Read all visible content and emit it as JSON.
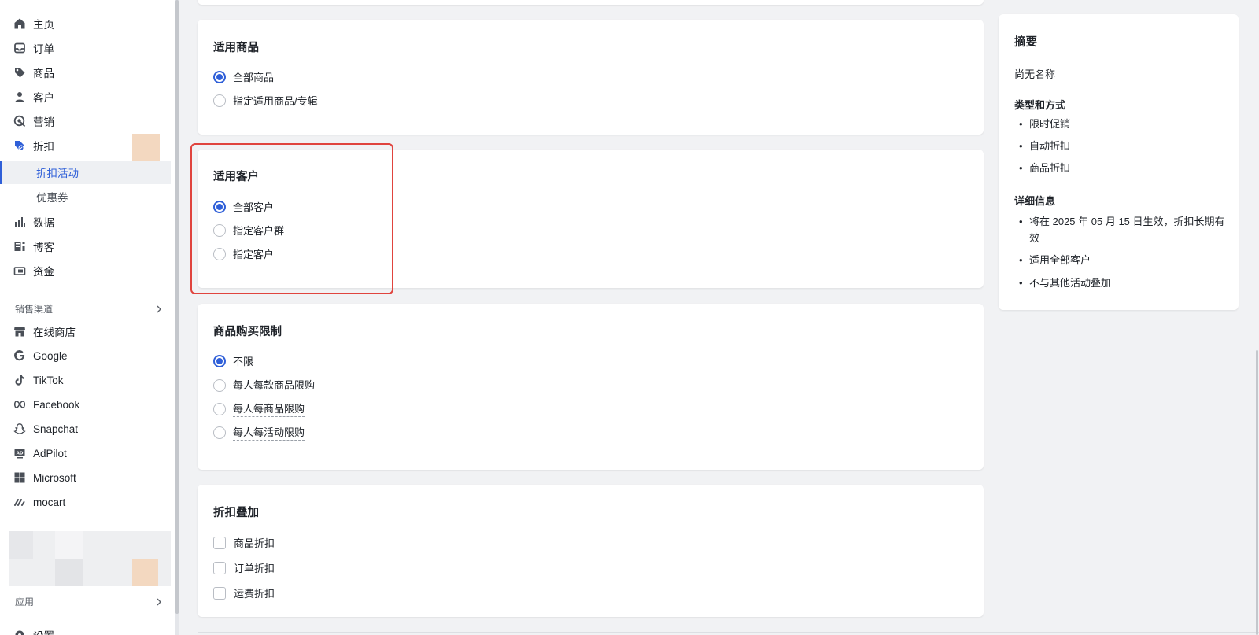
{
  "sidebar": {
    "items": [
      {
        "label": "主页"
      },
      {
        "label": "订单"
      },
      {
        "label": "商品"
      },
      {
        "label": "客户"
      },
      {
        "label": "营销"
      },
      {
        "label": "折扣"
      }
    ],
    "sub_items": [
      {
        "label": "折扣活动",
        "active": true
      },
      {
        "label": "优惠券"
      }
    ],
    "items2": [
      {
        "label": "数据"
      },
      {
        "label": "博客"
      },
      {
        "label": "资金"
      }
    ],
    "sales_channels_label": "销售渠道",
    "channels": [
      {
        "label": "在线商店"
      },
      {
        "label": "Google"
      },
      {
        "label": "TikTok"
      },
      {
        "label": "Facebook"
      },
      {
        "label": "Snapchat"
      },
      {
        "label": "AdPilot"
      },
      {
        "label": "Microsoft"
      },
      {
        "label": "mocart"
      }
    ],
    "apps_label": "应用",
    "settings_label": "设置"
  },
  "cards": {
    "products": {
      "title": "适用商品",
      "options": [
        "全部商品",
        "指定适用商品/专辑"
      ],
      "selected": 0
    },
    "customers": {
      "title": "适用客户",
      "options": [
        "全部客户",
        "指定客户群",
        "指定客户"
      ],
      "selected": 0
    },
    "limit": {
      "title": "商品购买限制",
      "options": [
        "不限",
        "每人每款商品限购",
        "每人每商品限购",
        "每人每活动限购"
      ],
      "selected": 0
    },
    "stacking": {
      "title": "折扣叠加",
      "options": [
        "商品折扣",
        "订单折扣",
        "运费折扣"
      ]
    }
  },
  "summary": {
    "title": "摘要",
    "name": "尚无名称",
    "type_title": "类型和方式",
    "type_items": [
      "限时促销",
      "自动折扣",
      "商品折扣"
    ],
    "detail_title": "详细信息",
    "detail_items": [
      "将在 2025 年 05 月 15 日生效，折扣长期有效",
      "适用全部客户",
      "不与其他活动叠加"
    ]
  },
  "colors": {
    "accent": "#2f5fd8",
    "highlight": "#e0443e"
  }
}
